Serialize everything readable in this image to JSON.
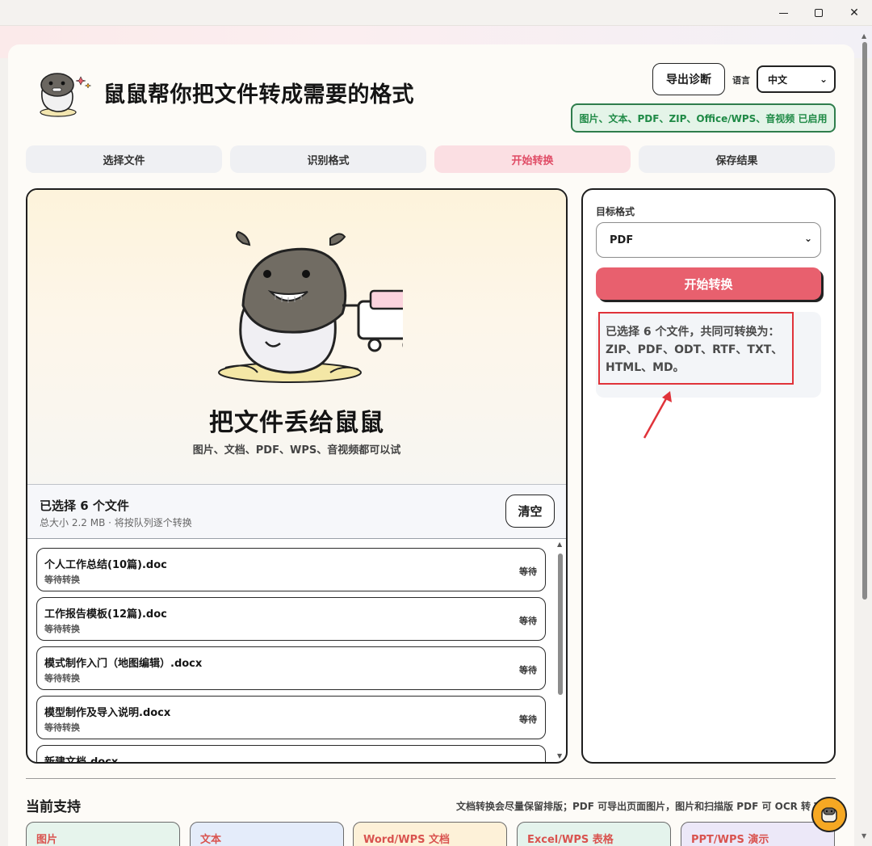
{
  "window": {
    "minimize_icon": "minimize-icon",
    "maximize_icon": "maximize-icon",
    "close_icon": "close-icon",
    "close_glyph": "✕"
  },
  "header": {
    "title": "鼠鼠帮你把文件转成需要的格式",
    "export_button": "导出诊断",
    "language_label": "语言",
    "language_value": "中文",
    "enabled_badge": "图片、文本、PDF、ZIP、Office/WPS、音视频 已启用"
  },
  "steps": [
    {
      "label": "选择文件",
      "active": false
    },
    {
      "label": "识别格式",
      "active": false
    },
    {
      "label": "开始转换",
      "active": true
    },
    {
      "label": "保存结果",
      "active": false
    }
  ],
  "drop_zone": {
    "title": "把文件丢给鼠鼠",
    "subtitle": "图片、文档、PDF、WPS、音视频都可以试"
  },
  "selection": {
    "title": "已选择 6 个文件",
    "subtitle": "总大小 2.2 MB · 将按队列逐个转换",
    "clear_button": "清空"
  },
  "files": [
    {
      "name": "个人工作总结(10篇).doc",
      "status": "等待转换",
      "state": "等待"
    },
    {
      "name": "工作报告模板(12篇).doc",
      "status": "等待转换",
      "state": "等待"
    },
    {
      "name": "模式制作入门（地图编辑）.docx",
      "status": "等待转换",
      "state": "等待"
    },
    {
      "name": "模型制作及导入说明.docx",
      "status": "等待转换",
      "state": "等待"
    },
    {
      "name": "新建文档.docx",
      "status": "",
      "state": ""
    }
  ],
  "conversion": {
    "target_label": "目标格式",
    "target_value": "PDF",
    "start_button": "开始转换",
    "hint": "已选择 6 个文件，共同可转换为：ZIP、PDF、ODT、RTF、TXT、HTML、MD。"
  },
  "support": {
    "title": "当前支持",
    "note": "文档转换会尽量保留排版；PDF 可导出页面图片，图片和扫描版 PDF 可 OCR 转 TX",
    "categories": [
      {
        "label": "图片",
        "color": "#d9534f",
        "bg": "#e6f4ec"
      },
      {
        "label": "文本",
        "color": "#d9534f",
        "bg": "#e4ecfa"
      },
      {
        "label": "Word/WPS 文档",
        "color": "#d9534f",
        "bg": "#fdf1d8"
      },
      {
        "label": "Excel/WPS 表格",
        "color": "#d9534f",
        "bg": "#e4f3ec"
      },
      {
        "label": "PPT/WPS 演示",
        "color": "#d9534f",
        "bg": "#ece8f8"
      }
    ]
  },
  "colors": {
    "accent": "#e8606e",
    "active_step_bg": "#fbdfe3",
    "badge_green": "#1f8a46",
    "highlight_red": "#e0333a"
  }
}
